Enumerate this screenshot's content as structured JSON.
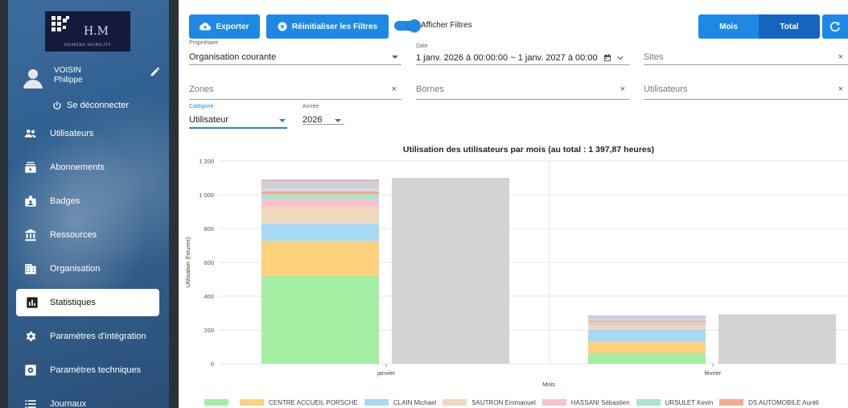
{
  "sidebar": {
    "logo_text": "H.M",
    "logo_sub": "HEMERA MOBILITY",
    "user_last": "VOISIN",
    "user_first": "Philippe",
    "logout_label": "Se déconnecter",
    "items": [
      {
        "label": "Utilisateurs",
        "icon": "users-icon"
      },
      {
        "label": "Abonnements",
        "icon": "subscriptions-icon"
      },
      {
        "label": "Badges",
        "icon": "badge-icon"
      },
      {
        "label": "Ressources",
        "icon": "bank-icon"
      },
      {
        "label": "Organisation",
        "icon": "building-icon"
      },
      {
        "label": "Statistiques",
        "icon": "chart-icon",
        "active": true
      },
      {
        "label": "Paramètres d'intégration",
        "icon": "gear-icon"
      },
      {
        "label": "Paramètres techniques",
        "icon": "settings-box-icon"
      },
      {
        "label": "Journaux",
        "icon": "list-icon"
      }
    ]
  },
  "toolbar": {
    "export_label": "Exporter",
    "reset_label": "Réinitialiser les Filtres",
    "toggle_label": "Afficher Filtres",
    "toggle_on": true,
    "mode_month": "Mois",
    "mode_total": "Total"
  },
  "filters": {
    "owner_label": "Propriétaire",
    "owner_value": "Organisation courante",
    "date_label": "Date",
    "date_value": "1 janv. 2026 à 00:00:00 ~ 1 janv. 2027 à 00:00",
    "sites_placeholder": "Sites",
    "zones_placeholder": "Zones",
    "bornes_placeholder": "Bornes",
    "users_placeholder": "Utilisateurs",
    "category_label": "Catégorie",
    "category_value": "Utilisateur",
    "year_label": "Année",
    "year_value": "2026",
    "clear_glyph": "×"
  },
  "colors": {
    "primary": "#1e88e5",
    "primary_dark": "#1565c0",
    "grey_bar": "#d3d3d3"
  },
  "chart_data": {
    "type": "bar",
    "title": "Utilisation des utilisateurs par mois (au total : 1 397,87 heures)",
    "xlabel": "Mois",
    "ylabel": "Utilisation (heures)",
    "ylim": [
      0,
      1200
    ],
    "yticks": [
      0,
      200,
      400,
      600,
      800,
      1000,
      1200
    ],
    "ytick_labels": [
      "0",
      "200",
      "400",
      "600",
      "800",
      "1 000",
      "1 200"
    ],
    "categories": [
      "janvier",
      "février"
    ],
    "stacked_series": [
      {
        "name": "",
        "color": "#a3eea3",
        "values": [
          520,
          62
        ]
      },
      {
        "name": "CENTRE ACCUEIL PORSCHE",
        "color": "#fdd17d",
        "values": [
          205,
          68
        ]
      },
      {
        "name": "CLAIN Michael",
        "color": "#a7d8f5",
        "values": [
          105,
          72
        ]
      },
      {
        "name": "SAUTRON Emmanuel",
        "color": "#efd9bd",
        "values": [
          95,
          22
        ]
      },
      {
        "name": "HASSANI Sébastien",
        "color": "#f9c2cb",
        "values": [
          48,
          14
        ]
      },
      {
        "name": "URSULET Kevin",
        "color": "#a9e4cf",
        "values": [
          30,
          10
        ]
      },
      {
        "name": "DS AUTOMOBILE Auréli",
        "color": "#f6a98f",
        "values": [
          16,
          7
        ]
      },
      {
        "name": "",
        "color": "#d9d9d9",
        "values": [
          20,
          8
        ]
      },
      {
        "name": "",
        "color": "#d4c4ef",
        "values": [
          14,
          6
        ]
      },
      {
        "name": "",
        "color": "#b9e3a0",
        "values": [
          14,
          5
        ]
      },
      {
        "name": "",
        "color": "#f2b8e0",
        "values": [
          13,
          6
        ]
      },
      {
        "name": "",
        "color": "#c6b6e8",
        "values": [
          10,
          5
        ]
      }
    ],
    "total_series": {
      "color": "#d3d3d3",
      "values": [
        1100,
        293
      ]
    },
    "grid": true,
    "legend_position": "bottom"
  }
}
